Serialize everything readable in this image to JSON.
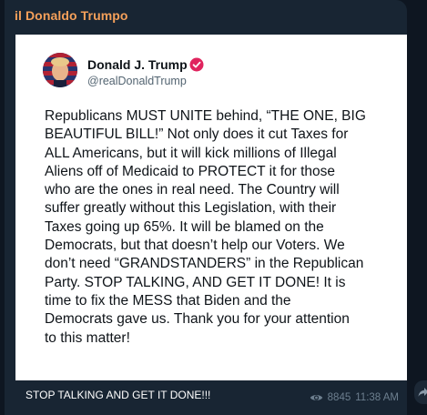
{
  "channel": {
    "name": "il Donaldo Trumpo"
  },
  "post": {
    "author_name": "Donald J. Trump",
    "author_handle": "@realDonaldTrump",
    "verified_icon": "verified-badge-icon",
    "avatar_icon": "profile-avatar",
    "text": "Republicans MUST UNITE behind, “THE ONE, BIG\nBEAUTIFUL BILL!” Not only does it cut Taxes for\nALL Americans, but it will kick millions of Illegal\nAliens off of Medicaid to PROTECT it for those\nwho are the ones in real need. The Country will\nsuffer greatly without this Legislation, with their\nTaxes going up 65%. It will be blamed on the\nDemocrats, but that doesn’t help our Voters. We\ndon’t need “GRANDSTANDERS” in the Republican\nParty. STOP TALKING, AND GET IT DONE! It is\ntime to fix the MESS that Biden and the\nDemocrats gave us. Thank you for your attention\nto this matter!"
  },
  "message": {
    "caption": "STOP TALKING AND GET IT DONE!!!",
    "views": "8845",
    "time": "11:38 AM",
    "views_icon": "eye-icon",
    "forward_icon": "forward-icon"
  },
  "colors": {
    "background": "#0e1621",
    "bubble": "#182533",
    "channel_name": "#f5a05a",
    "verified": "#e0245e",
    "meta": "#6d7f8f"
  }
}
